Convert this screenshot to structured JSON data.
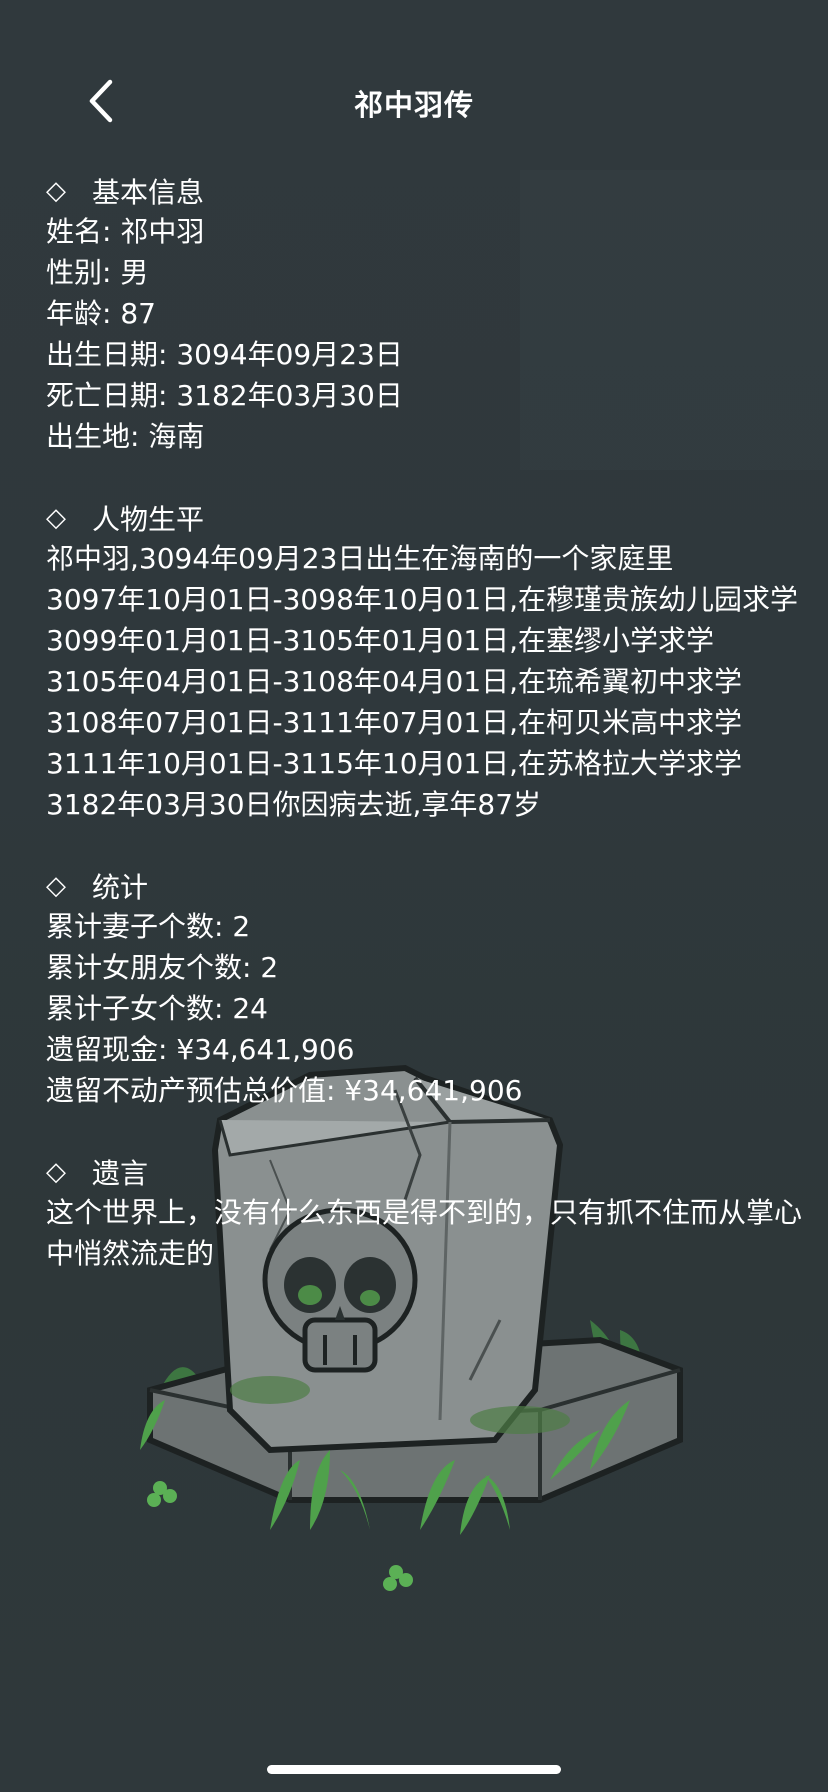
{
  "header": {
    "title": "祁中羽传",
    "back_icon": "chevron-left-icon"
  },
  "sections": {
    "basic": {
      "marker": "◇",
      "title": "基本信息",
      "lines": [
        "姓名: 祁中羽",
        "性别: 男",
        "年龄: 87",
        "出生日期: 3094年09月23日",
        "死亡日期: 3182年03月30日",
        "出生地: 海南"
      ]
    },
    "life": {
      "marker": "◇",
      "title": "人物生平",
      "lines": [
        "祁中羽,3094年09月23日出生在海南的一个家庭里",
        "3097年10月01日-3098年10月01日,在穆瑾贵族幼儿园求学",
        "3099年01月01日-3105年01月01日,在塞缪小学求学",
        "3105年04月01日-3108年04月01日,在琉希翼初中求学",
        "3108年07月01日-3111年07月01日,在柯贝米高中求学",
        "3111年10月01日-3115年10月01日,在苏格拉大学求学",
        "3182年03月30日你因病去逝,享年87岁"
      ]
    },
    "stats": {
      "marker": "◇",
      "title": "统计",
      "lines": [
        "累计妻子个数: 2",
        "累计女朋友个数: 2",
        "累计子女个数: 24",
        "遗留现金: ¥34,641,906",
        "遗留不动产预估总价值: ¥34,641,906"
      ]
    },
    "will": {
      "marker": "◇",
      "title": "遗言",
      "text": "这个世界上，没有什么东西是得不到的，只有抓不住而从掌心中悄然流走的"
    }
  },
  "colors": {
    "background": "#2f383c",
    "text": "#ffffff"
  },
  "illustration": "tombstone-skull-icon"
}
